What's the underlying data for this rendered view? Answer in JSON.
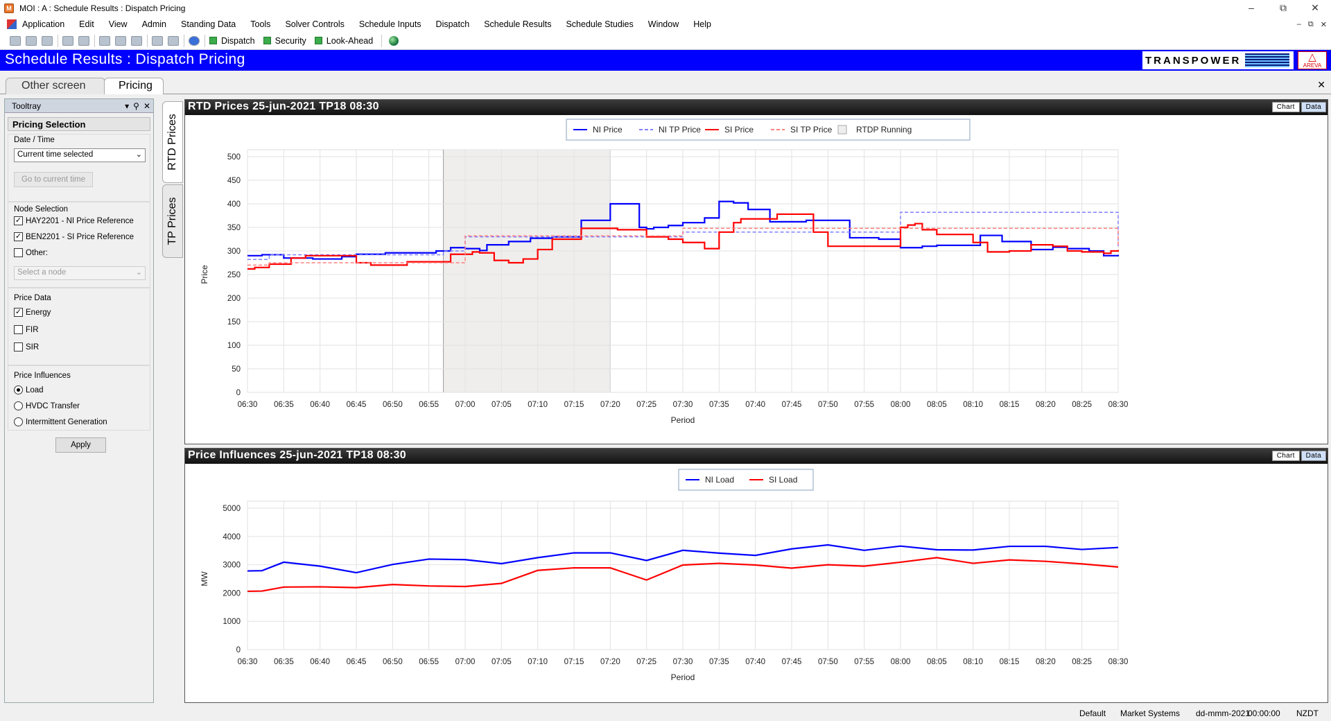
{
  "window": {
    "title": "MOI : A : Schedule Results : Dispatch Pricing",
    "icon": "moi-app-icon"
  },
  "menu": [
    "Application",
    "Edit",
    "View",
    "Admin",
    "Standing Data",
    "Tools",
    "Solver Controls",
    "Schedule Inputs",
    "Dispatch",
    "Schedule Results",
    "Schedule Studies",
    "Window",
    "Help"
  ],
  "toolbar": {
    "dispatch": "Dispatch",
    "security": "Security",
    "lookahead": "Look-Ahead"
  },
  "header": {
    "title": "Schedule Results : Dispatch Pricing",
    "logo": "TRANSPOWER",
    "areva": "AREVA"
  },
  "tabs": [
    "Other screen",
    "Pricing"
  ],
  "tooltray": {
    "title": "Tooltray",
    "section": "Pricing Selection",
    "datetime_label": "Date / Time",
    "datetime_value": "Current time selected",
    "goto_btn": "Go to current time",
    "node_label": "Node Selection",
    "node1": "HAY2201 - NI Price Reference",
    "node2": "BEN2201 - SI Price Reference",
    "other": "Other:",
    "node_placeholder": "Select a node",
    "price_data_label": "Price Data",
    "energy": "Energy",
    "fir": "FIR",
    "sir": "SIR",
    "influences_label": "Price Influences",
    "load": "Load",
    "hvdc": "HVDC Transfer",
    "intermittent": "Intermittent Generation",
    "apply": "Apply"
  },
  "side_tabs": [
    "RTD Prices",
    "TP Prices"
  ],
  "panel_buttons": {
    "chart": "Chart",
    "data": "Data"
  },
  "status": {
    "default": "Default",
    "market": "Market Systems",
    "date": "dd-mmm-2021",
    "time": "00:00:00",
    "tz": "NZDT"
  },
  "colors": {
    "header_blue": "#0000ff",
    "ni": "#0000ff",
    "si": "#ff0000",
    "ni_tp": "#8080ff",
    "si_tp": "#ff8080"
  },
  "chart_data": [
    {
      "type": "line",
      "title": "RTD Prices 25-jun-2021  TP18  08:30",
      "xlabel": "Period",
      "ylabel": "Price",
      "ylim": [
        0,
        500
      ],
      "yticks": [
        0,
        50,
        100,
        150,
        200,
        250,
        300,
        350,
        400,
        450,
        500
      ],
      "categories": [
        "06:30",
        "06:35",
        "06:40",
        "06:45",
        "06:50",
        "06:55",
        "07:00",
        "07:05",
        "07:10",
        "07:15",
        "07:20",
        "07:25",
        "07:30",
        "07:35",
        "07:40",
        "07:45",
        "07:50",
        "07:55",
        "08:00",
        "08:05",
        "08:10",
        "08:15",
        "08:20",
        "08:25",
        "08:30"
      ],
      "shaded_range": [
        "06:57",
        "07:20"
      ],
      "legend": [
        "NI Price",
        "NI TP Price",
        "SI Price",
        "SI TP Price",
        "RTDP Running"
      ],
      "series": [
        {
          "name": "NI Price",
          "style": "solid",
          "color": "#0000ff",
          "x": [
            "06:30",
            "06:32",
            "06:35",
            "06:39",
            "06:43",
            "06:45",
            "06:49",
            "06:56",
            "06:58",
            "07:00",
            "07:02",
            "07:03",
            "07:06",
            "07:09",
            "07:12",
            "07:16",
            "07:20",
            "07:24",
            "07:25",
            "07:26",
            "07:28",
            "07:30",
            "07:33",
            "07:35",
            "07:37",
            "07:39",
            "07:42",
            "07:47",
            "07:49",
            "07:53",
            "07:57",
            "08:00",
            "08:03",
            "08:05",
            "08:09",
            "08:11",
            "08:14",
            "08:18",
            "08:21",
            "08:23",
            "08:26",
            "08:28",
            "08:30"
          ],
          "values": [
            290,
            292,
            285,
            283,
            288,
            293,
            296,
            300,
            307,
            305,
            301,
            313,
            320,
            327,
            330,
            365,
            400,
            350,
            347,
            350,
            354,
            360,
            370,
            405,
            402,
            388,
            362,
            365,
            365,
            328,
            325,
            307,
            310,
            312,
            312,
            333,
            320,
            303,
            308,
            305,
            300,
            290,
            292
          ]
        },
        {
          "name": "NI TP Price",
          "style": "dashed",
          "color": "#8080ff",
          "x": [
            "06:30",
            "06:33",
            "06:57",
            "07:00",
            "07:30",
            "08:00",
            "08:30"
          ],
          "values": [
            282,
            292,
            300,
            330,
            340,
            382,
            310
          ]
        },
        {
          "name": "SI Price",
          "style": "solid",
          "color": "#ff0000",
          "x": [
            "06:30",
            "06:31",
            "06:33",
            "06:36",
            "06:38",
            "06:43",
            "06:45",
            "06:47",
            "06:49",
            "06:52",
            "06:58",
            "07:01",
            "07:02",
            "07:04",
            "07:06",
            "07:08",
            "07:10",
            "07:12",
            "07:16",
            "07:21",
            "07:25",
            "07:28",
            "07:30",
            "07:33",
            "07:35",
            "07:37",
            "07:38",
            "07:43",
            "07:46",
            "07:48",
            "07:50",
            "08:00",
            "08:01",
            "08:02",
            "08:03",
            "08:05",
            "08:10",
            "08:12",
            "08:15",
            "08:18",
            "08:21",
            "08:23",
            "08:25",
            "08:28",
            "08:29",
            "08:30"
          ],
          "values": [
            262,
            265,
            272,
            285,
            290,
            290,
            275,
            270,
            270,
            277,
            293,
            298,
            296,
            280,
            275,
            283,
            303,
            325,
            348,
            345,
            330,
            325,
            318,
            305,
            340,
            360,
            368,
            378,
            378,
            340,
            310,
            350,
            355,
            358,
            345,
            335,
            318,
            298,
            300,
            313,
            310,
            300,
            298,
            295,
            300,
            302
          ]
        },
        {
          "name": "SI TP Price",
          "style": "dashed",
          "color": "#ff8080",
          "x": [
            "06:30",
            "06:33",
            "06:57",
            "07:00",
            "07:30",
            "08:00",
            "08:30"
          ],
          "values": [
            270,
            275,
            275,
            332,
            348,
            348,
            308
          ]
        }
      ]
    },
    {
      "type": "line",
      "title": "Price Influences 25-jun-2021  TP18  08:30",
      "xlabel": "Period",
      "ylabel": "MW",
      "ylim": [
        0,
        5000
      ],
      "yticks": [
        0,
        1000,
        2000,
        3000,
        4000,
        5000
      ],
      "categories": [
        "06:30",
        "06:35",
        "06:40",
        "06:45",
        "06:50",
        "06:55",
        "07:00",
        "07:05",
        "07:10",
        "07:15",
        "07:20",
        "07:25",
        "07:30",
        "07:35",
        "07:40",
        "07:45",
        "07:50",
        "07:55",
        "08:00",
        "08:05",
        "08:10",
        "08:15",
        "08:20",
        "08:25",
        "08:30"
      ],
      "legend": [
        "NI Load",
        "SI Load"
      ],
      "series": [
        {
          "name": "NI Load",
          "color": "#0000ff",
          "x": [
            "06:30",
            "06:32",
            "06:35",
            "06:40",
            "06:45",
            "06:50",
            "06:55",
            "07:00",
            "07:05",
            "07:10",
            "07:15",
            "07:20",
            "07:25",
            "07:30",
            "07:35",
            "07:40",
            "07:45",
            "07:50",
            "07:55",
            "08:00",
            "08:05",
            "08:10",
            "08:15",
            "08:20",
            "08:25",
            "08:30"
          ],
          "values": [
            2780,
            2790,
            3090,
            2950,
            2720,
            3010,
            3200,
            3180,
            3040,
            3250,
            3420,
            3420,
            3150,
            3510,
            3410,
            3330,
            3560,
            3700,
            3510,
            3660,
            3530,
            3520,
            3650,
            3650,
            3540,
            3610
          ]
        },
        {
          "name": "SI Load",
          "color": "#ff0000",
          "x": [
            "06:30",
            "06:32",
            "06:35",
            "06:40",
            "06:45",
            "06:50",
            "06:55",
            "07:00",
            "07:05",
            "07:10",
            "07:15",
            "07:20",
            "07:25",
            "07:30",
            "07:35",
            "07:40",
            "07:45",
            "07:50",
            "07:55",
            "08:00",
            "08:05",
            "08:10",
            "08:15",
            "08:20",
            "08:25",
            "08:30"
          ],
          "values": [
            2060,
            2070,
            2210,
            2220,
            2190,
            2300,
            2250,
            2230,
            2340,
            2800,
            2890,
            2890,
            2460,
            2990,
            3050,
            2990,
            2880,
            3000,
            2950,
            3090,
            3250,
            3050,
            3170,
            3120,
            3030,
            2920
          ]
        }
      ]
    }
  ]
}
